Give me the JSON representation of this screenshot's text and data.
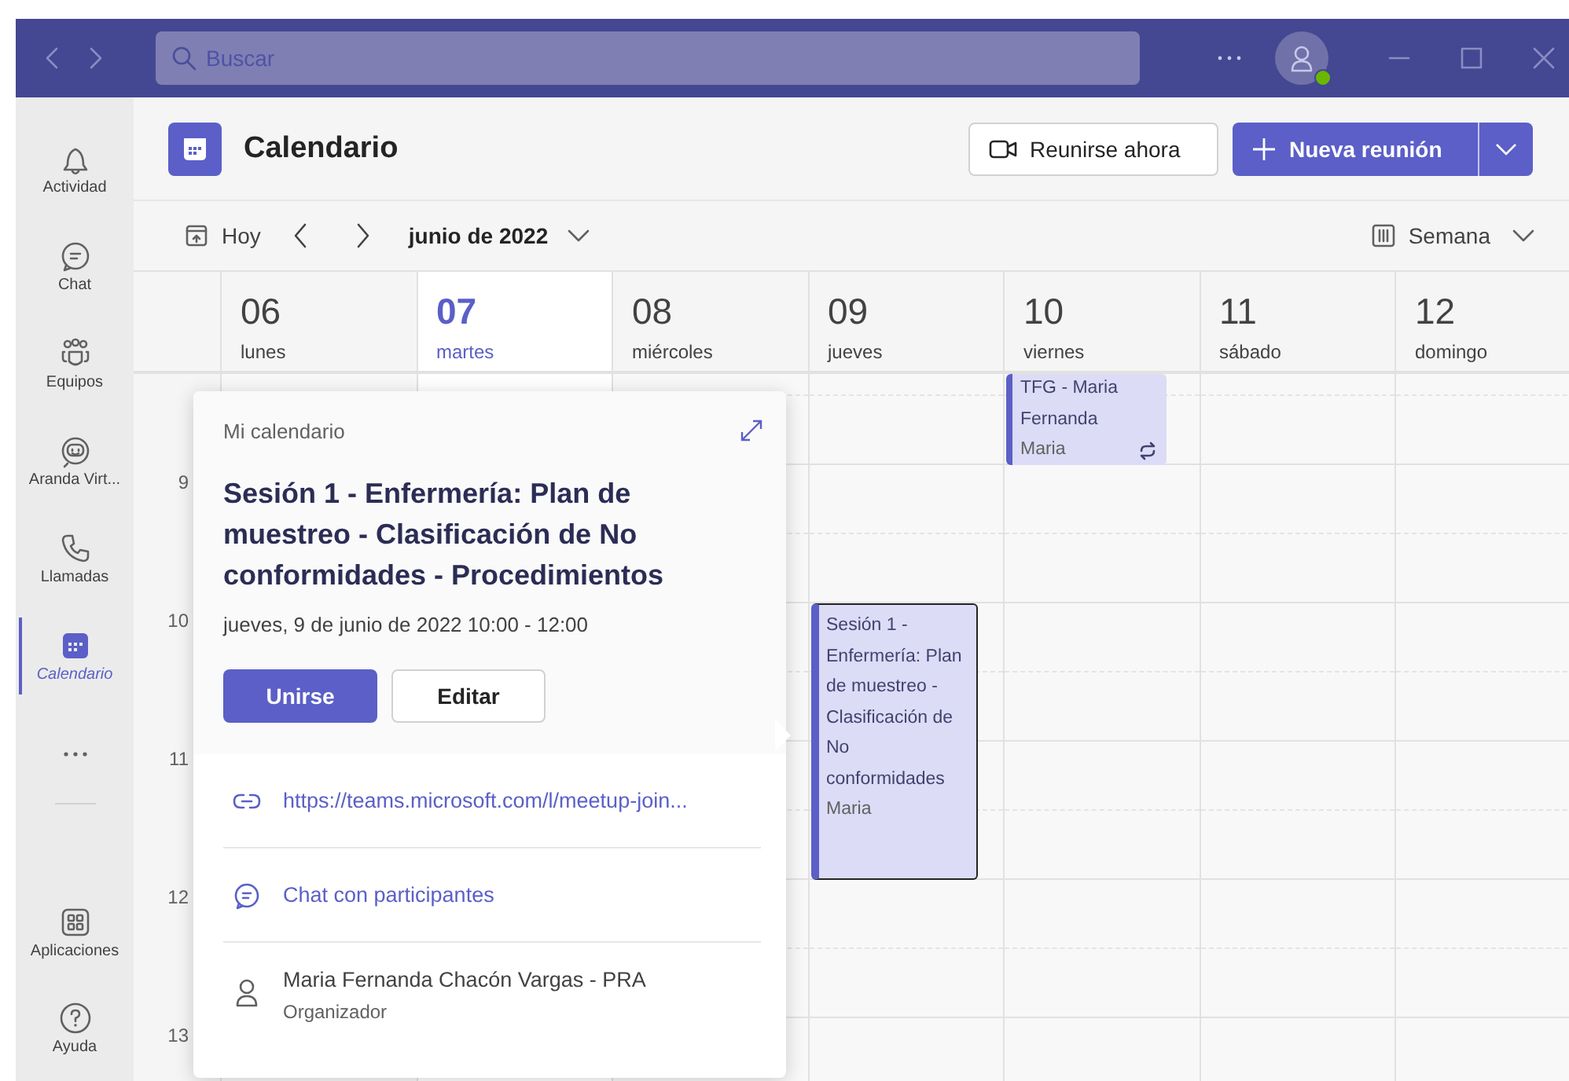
{
  "titlebar": {
    "search": {
      "placeholder": "Buscar"
    }
  },
  "rail": {
    "top": [
      {
        "kind": "bell",
        "label": "Actividad",
        "selected": false
      },
      {
        "kind": "chat",
        "label": "Chat",
        "selected": false
      },
      {
        "kind": "teams",
        "label": "Equipos",
        "selected": false
      },
      {
        "kind": "bot",
        "label": "Aranda Virt...",
        "selected": false
      },
      {
        "kind": "phone",
        "label": "Llamadas",
        "selected": false
      },
      {
        "kind": "calendar",
        "label": "Calendario",
        "selected": true
      },
      {
        "kind": "more",
        "selected": false
      }
    ],
    "bottom": [
      {
        "kind": "apps",
        "label": "Aplicaciones",
        "selected": false
      },
      {
        "kind": "help",
        "label": "Ayuda",
        "selected": false
      }
    ]
  },
  "header": {
    "title": "Calendario",
    "buttons": [
      {
        "kind": "secondary",
        "label": "Reunirse ahora"
      },
      {
        "kind": "primary",
        "label": "Nueva reunión"
      }
    ]
  },
  "toolbar": {
    "today": "Hoy",
    "period": "junio de 2022",
    "view": "Semana"
  },
  "days": [
    {
      "number": "06",
      "name": "lunes",
      "selected": false
    },
    {
      "number": "07",
      "name": "martes",
      "selected": true
    },
    {
      "number": "08",
      "name": "miércoles",
      "selected": false
    },
    {
      "number": "09",
      "name": "jueves",
      "selected": false,
      "events": [
        {
          "title": "Sesión 1 - Enfermería: Plan de muestreo - Clasificación de No conformidades",
          "organizer": "Maria",
          "recurring": false,
          "selected": true
        }
      ]
    },
    {
      "number": "10",
      "name": "viernes",
      "selected": false,
      "events": [
        {
          "title": "TFG - Maria Fernanda",
          "organizer": "Maria",
          "recurring": true,
          "selected": false
        }
      ]
    },
    {
      "number": "11",
      "name": "sábado",
      "selected": false
    },
    {
      "number": "12",
      "name": "domingo",
      "selected": false
    }
  ],
  "hours": [
    "9",
    "10",
    "11",
    "12",
    "13"
  ],
  "popup": {
    "calendar": "Mi calendario",
    "title": "Sesión 1 - Enfermería: Plan de muestreo - Clasificación de No conformidades - Procedimientos",
    "when": "jueves, 9 de junio de 2022 10:00 - 12:00",
    "actions": [
      {
        "kind": "primary",
        "label": "Unirse"
      },
      {
        "kind": "secondary",
        "label": "Editar"
      }
    ],
    "link": "https://teams.microsoft.com/l/meetup-join...",
    "chat": "Chat con participantes",
    "organizer": {
      "name": "Maria Fernanda Chacón Vargas - PRA",
      "role": "Organizador"
    }
  }
}
